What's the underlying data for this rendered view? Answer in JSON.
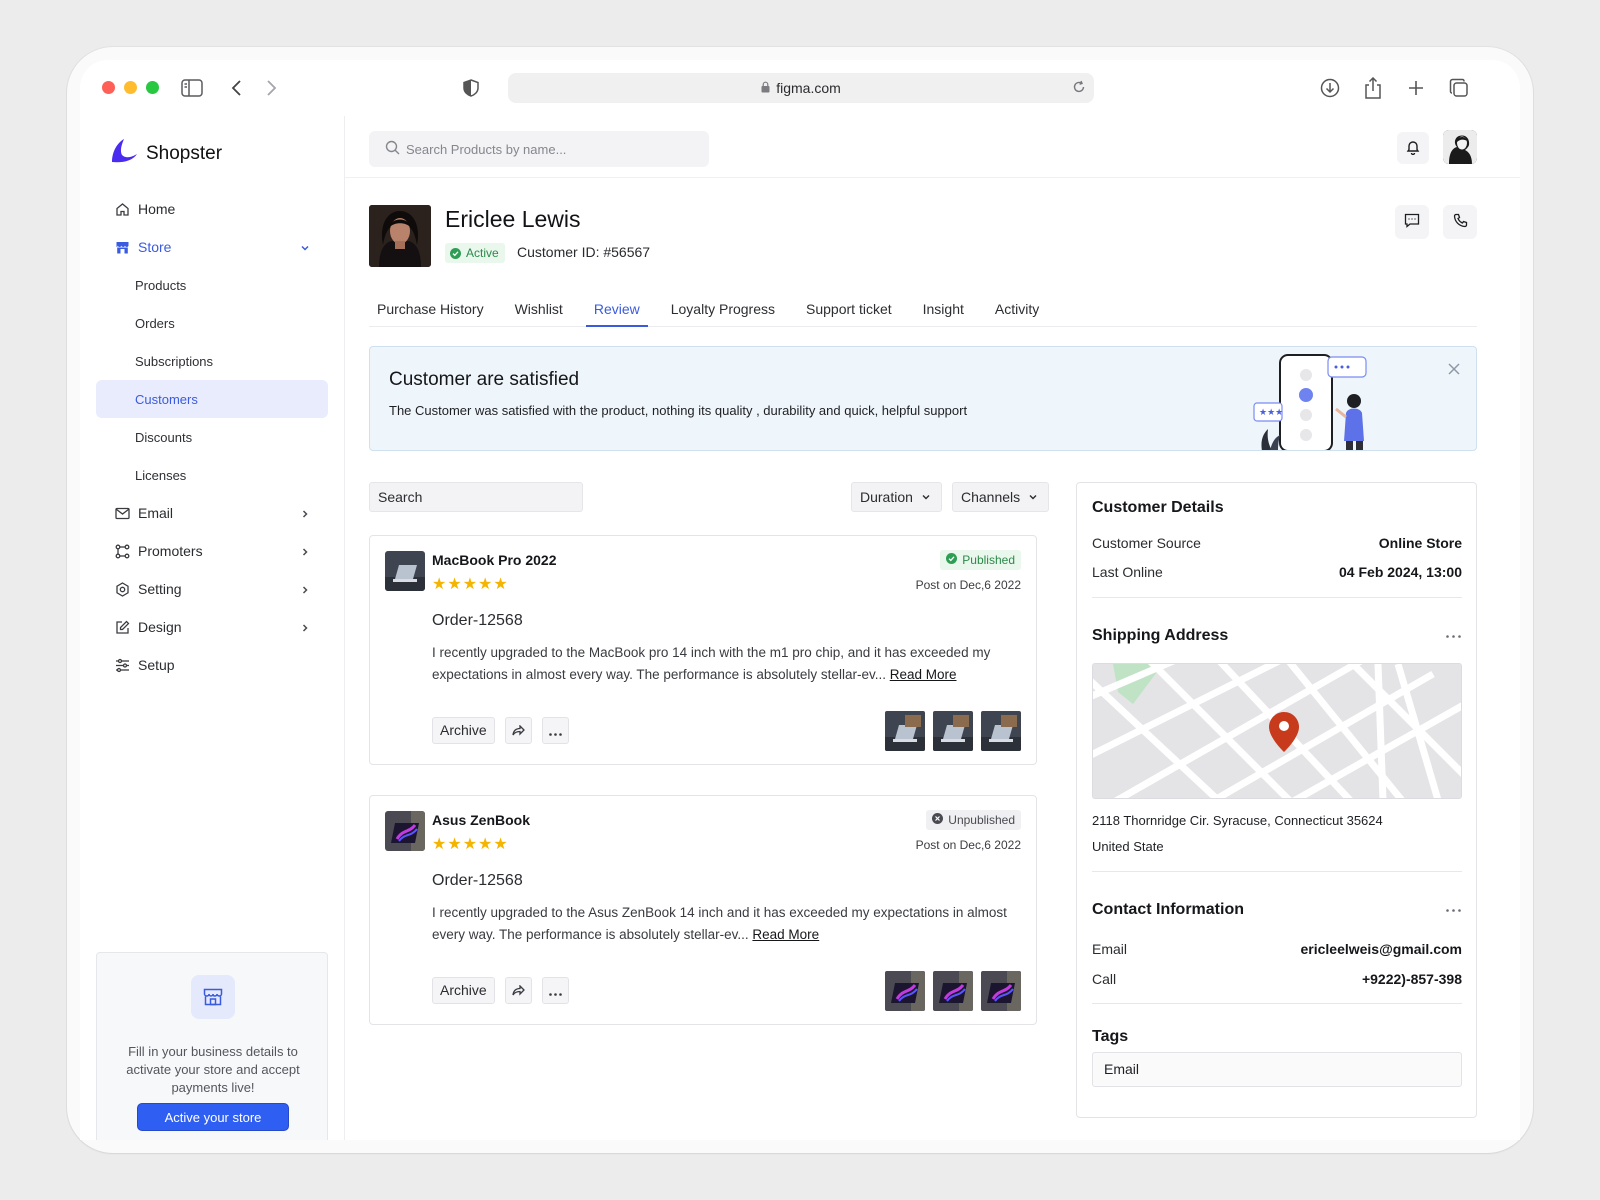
{
  "browser": {
    "url": "figma.com"
  },
  "app": {
    "name": "Shopster"
  },
  "sidebar": {
    "items": [
      {
        "label": "Home"
      },
      {
        "label": "Store"
      },
      {
        "label": "Products"
      },
      {
        "label": "Orders"
      },
      {
        "label": "Subscriptions"
      },
      {
        "label": "Customers"
      },
      {
        "label": "Discounts"
      },
      {
        "label": "Licenses"
      },
      {
        "label": "Email"
      },
      {
        "label": "Promoters"
      },
      {
        "label": "Setting"
      },
      {
        "label": "Design"
      },
      {
        "label": "Setup"
      }
    ],
    "promo": {
      "text": "Fill in your business details to activate your store and accept payments live!",
      "button": "Active your store"
    }
  },
  "search": {
    "placeholder": "Search Products by name..."
  },
  "customer": {
    "name": "Ericlee Lewis",
    "status": "Active",
    "id_label": "Customer ID: #56567"
  },
  "tabs": [
    {
      "label": "Purchase History"
    },
    {
      "label": "Wishlist"
    },
    {
      "label": "Review"
    },
    {
      "label": "Loyalty Progress"
    },
    {
      "label": "Support ticket"
    },
    {
      "label": "Insight"
    },
    {
      "label": "Activity"
    }
  ],
  "banner": {
    "title": "Customer are satisfied",
    "text": "The Customer  was satisfied with the product, nothing its quality , durability and quick, helpful support"
  },
  "filters": {
    "search": "Search",
    "duration": "Duration",
    "channels": "Channels"
  },
  "reviews": [
    {
      "product": "MacBook Pro 2022",
      "stars": "★★★★★",
      "status": "Published",
      "date": "Post on Dec,6 2022",
      "order": "Order-12568",
      "body": "I recently upgraded to the MacBook pro 14 inch with the m1 pro chip, and it has exceeded my expectations in almost every way. The performance is absolutely stellar-ev...",
      "read_more": "Read More",
      "archive": "Archive"
    },
    {
      "product": "Asus ZenBook",
      "stars": "★★★★★",
      "status": "Unpublished",
      "date": "Post on Dec,6 2022",
      "order": "Order-12568",
      "body": "I recently upgraded to the Asus ZenBook 14 inch  and it has exceeded my expectations in almost every way. The performance is absolutely stellar-ev...",
      "read_more": "Read More",
      "archive": "Archive"
    }
  ],
  "details": {
    "title": "Customer Details",
    "source_label": "Customer Source",
    "source_value": "Online Store",
    "last_online_label": "Last Online",
    "last_online_value": "04 Feb 2024, 13:00",
    "shipping_title": "Shipping Address",
    "address_line1": "2118 Thornridge Cir. Syracuse, Connecticut 35624",
    "address_line2": "United State",
    "contact_title": "Contact Information",
    "email_label": "Email",
    "email_value": "ericleelweis@gmail.com",
    "call_label": "Call",
    "call_value": "+9222)-857-398",
    "tags_title": "Tags",
    "tag_value": "Email"
  },
  "colors": {
    "accent": "#3a5be0",
    "button": "#2f5ef2",
    "published": "#2c8a4a",
    "star": "#f4b400"
  }
}
